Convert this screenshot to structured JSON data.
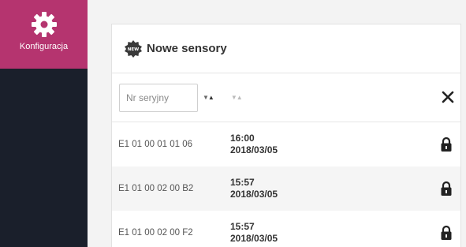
{
  "sidebar": {
    "items": [
      {
        "label": "Konfiguracja",
        "icon": "gear-icon",
        "active": true
      }
    ],
    "colors": {
      "active_bg": "#b5346f",
      "bg": "#1a1f2b"
    }
  },
  "panel": {
    "icon": "new-badge-icon",
    "title": "Nowe sensory",
    "filter": {
      "placeholder": "Nr seryjny",
      "value": ""
    },
    "rows": [
      {
        "serial": "E1 01 00 01 01 06",
        "time": "16:00",
        "date": "2018/03/05",
        "icon": "lock-icon"
      },
      {
        "serial": "E1 01 00 02 00 B2",
        "time": "15:57",
        "date": "2018/03/05",
        "icon": "lock-icon"
      },
      {
        "serial": "E1 01 00 02 00 F2",
        "time": "15:57",
        "date": "2018/03/05",
        "icon": "lock-icon"
      }
    ]
  }
}
